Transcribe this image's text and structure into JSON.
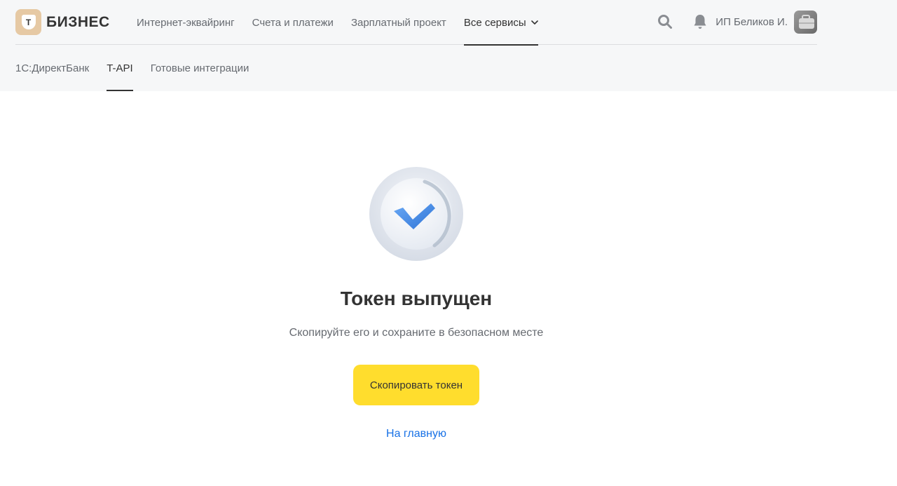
{
  "header": {
    "logo": {
      "badge_letter": "Т",
      "text": "БИЗНЕС"
    },
    "nav": [
      {
        "label": "Интернет-эквайринг"
      },
      {
        "label": "Счета и платежи"
      },
      {
        "label": "Зарплатный проект"
      },
      {
        "label": "Все сервисы"
      }
    ],
    "user_name": "ИП Беликов И."
  },
  "subnav": [
    {
      "label": "1С:ДиректБанк"
    },
    {
      "label": "T-API"
    },
    {
      "label": "Готовые интеграции"
    }
  ],
  "main": {
    "title": "Токен выпущен",
    "subtitle": "Скопируйте его и сохраните в безопасном месте",
    "copy_button": "Скопировать токен",
    "home_link": "На главную"
  },
  "colors": {
    "primary_button": "#ffdd2d",
    "link": "#1771e6",
    "header_bg": "#f6f7f8",
    "check_blue": "#4a8fe8"
  }
}
